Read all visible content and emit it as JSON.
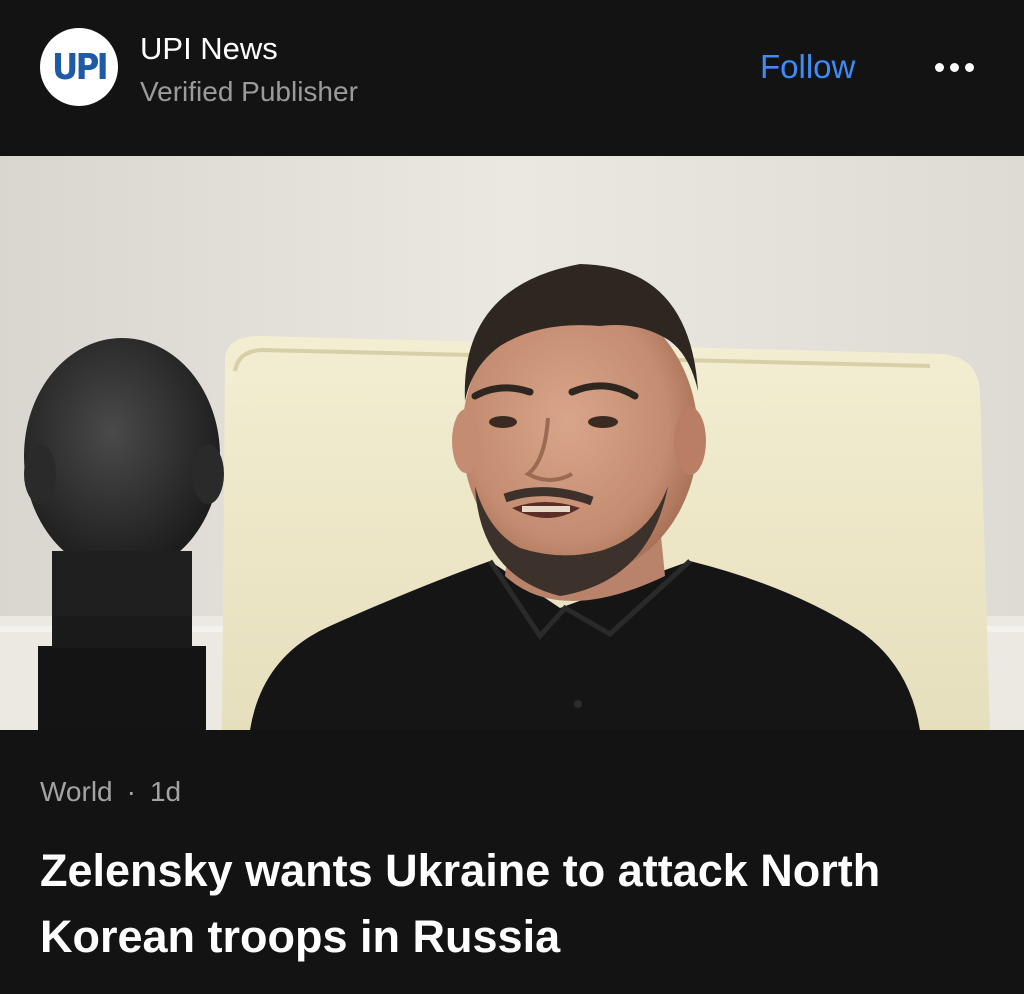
{
  "publisher": {
    "logo_text": "UPI",
    "name": "UPI News",
    "subtitle": "Verified Publisher",
    "follow_label": "Follow",
    "more_icon": "more-horizontal-icon"
  },
  "article": {
    "category": "World",
    "separator": "·",
    "age": "1d",
    "headline": "Zelensky wants Ukraine to attack North Korean troops in Russia"
  },
  "colors": {
    "background": "#131313",
    "accent": "#3d8bf5",
    "logo_blue": "#1f5aa6",
    "secondary_text": "#9b9b9b"
  }
}
